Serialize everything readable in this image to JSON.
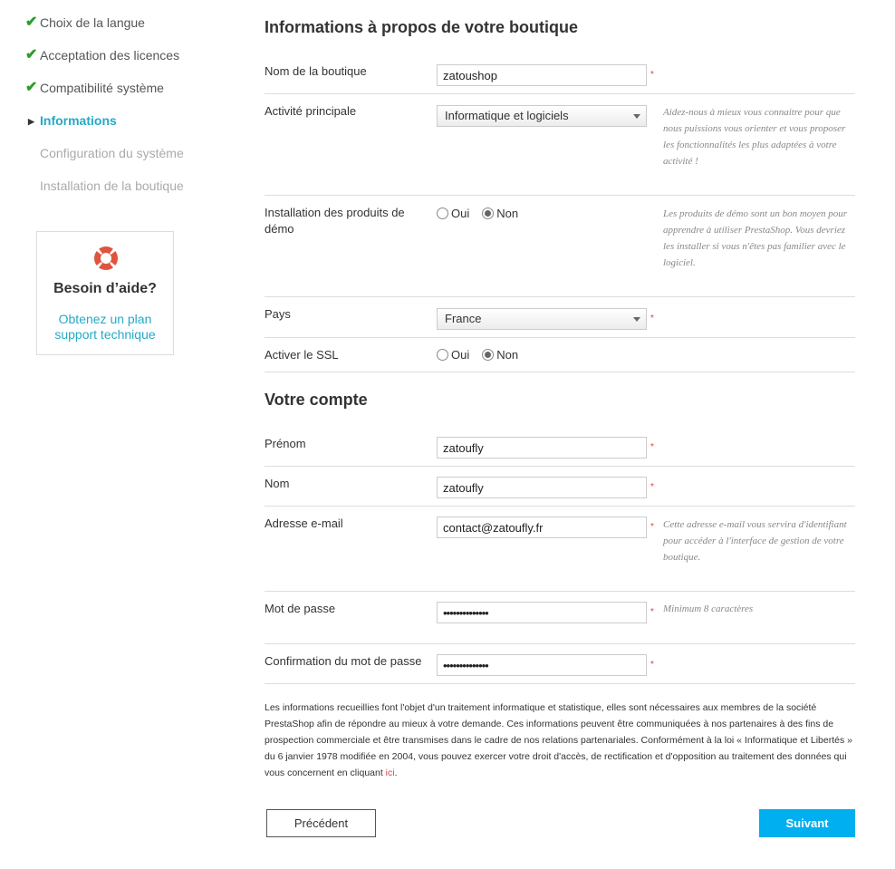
{
  "sidebar": {
    "steps": [
      {
        "label": "Choix de la langue",
        "state": "done",
        "mark": "✔"
      },
      {
        "label": "Acceptation des licences",
        "state": "done",
        "mark": "✔"
      },
      {
        "label": "Compatibilité système",
        "state": "done",
        "mark": "✔"
      },
      {
        "label": "Informations",
        "state": "active",
        "mark": "▶"
      },
      {
        "label": "Configuration du système",
        "state": "todo",
        "mark": ""
      },
      {
        "label": "Installation de la boutique",
        "state": "todo",
        "mark": ""
      }
    ],
    "help": {
      "icon": "lifebuoy-icon",
      "title": "Besoin d’aide?",
      "link_line1": "Obtenez un plan",
      "link_line2": "support technique"
    }
  },
  "shop": {
    "title": "Informations à propos de votre boutique",
    "name_label": "Nom de la boutique",
    "name_value": "zatoushop",
    "activity_label": "Activité principale",
    "activity_value": "Informatique et logiciels",
    "activity_hint": "Aidez-nous à mieux vous connaitre pour que nous puissions vous orienter et vous proposer les fonctionnalités les plus adaptées à votre activité !",
    "demo_label": "Installation des produits de démo",
    "demo_yes": "Oui",
    "demo_no": "Non",
    "demo_selected": "Non",
    "demo_hint": "Les produits de démo sont un bon moyen pour apprendre à utiliser PrestaShop. Vous devriez les installer si vous n'êtes pas familier avec le logiciel.",
    "country_label": "Pays",
    "country_value": "France",
    "ssl_label": "Activer le SSL",
    "ssl_yes": "Oui",
    "ssl_no": "Non",
    "ssl_selected": "Non"
  },
  "account": {
    "title": "Votre compte",
    "firstname_label": "Prénom",
    "firstname_value": "zatoufly",
    "lastname_label": "Nom",
    "lastname_value": "zatoufly",
    "email_label": "Adresse e-mail",
    "email_value": "contact@zatoufly.fr",
    "email_hint": "Cette adresse e-mail vous servira d'identifiant pour accéder à l'interface de gestion de votre boutique.",
    "password_label": "Mot de passe",
    "password_value": "••••••••••••••",
    "password_hint": "Minimum 8 caractères",
    "confirm_label": "Confirmation du mot de passe",
    "confirm_value": "••••••••••••••"
  },
  "required_mark": "*",
  "legal": {
    "text": "Les informations recueillies font l'objet d'un traitement informatique et statistique, elles sont nécessaires aux membres de la société PrestaShop afin de répondre au mieux à votre demande. Ces informations peuvent être communiquées à nos partenaires à des fins de prospection commerciale et être transmises dans le cadre de nos relations partenariales. Conformément à la loi « Informatique et Libertés » du 6 janvier 1978 modifiée en 2004, vous pouvez exercer votre droit d'accès, de rectification et d'opposition au traitement des données qui vous concernent en cliquant ",
    "link": "ici",
    "end": "."
  },
  "buttons": {
    "previous": "Précédent",
    "next": "Suivant"
  },
  "colors": {
    "accent": "#25a9c6",
    "primary_button": "#00aff0",
    "check": "#2a9d2a",
    "required": "#e04040"
  }
}
